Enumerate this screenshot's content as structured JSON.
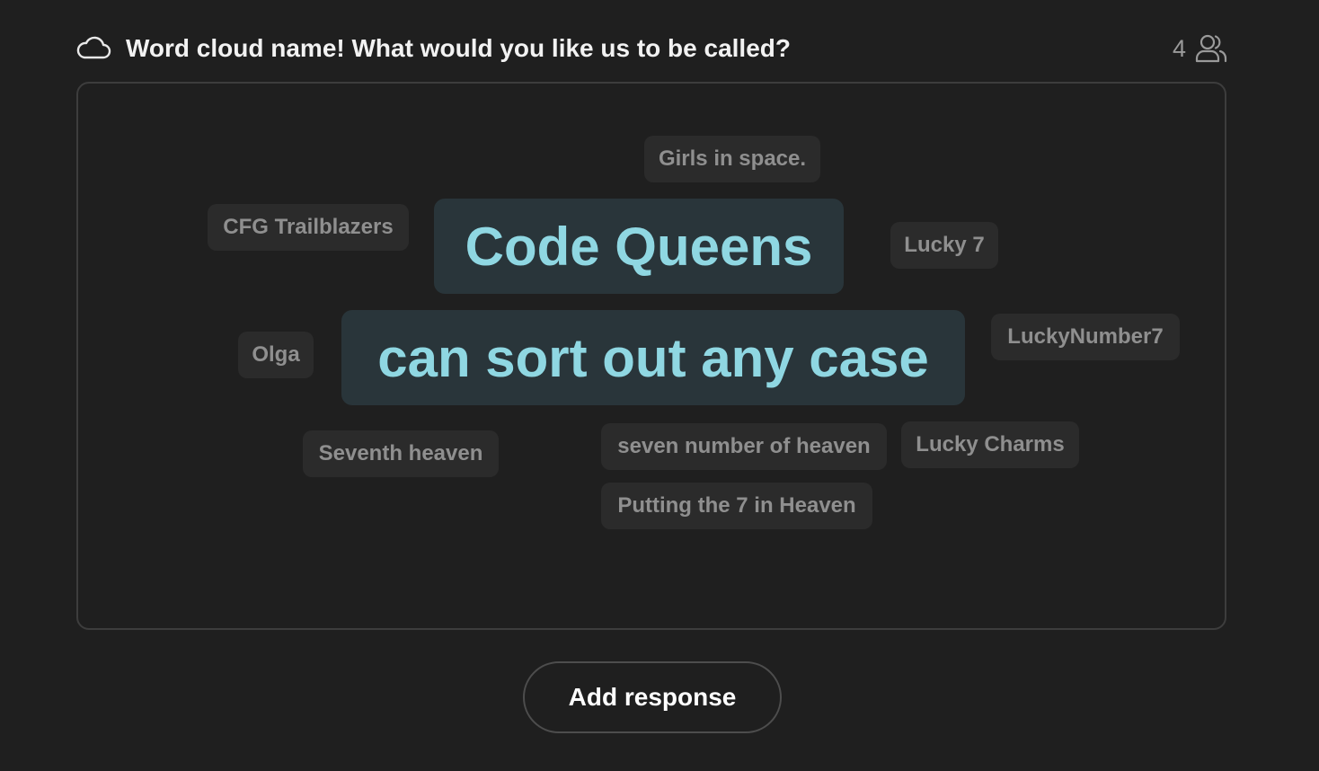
{
  "header": {
    "icon": "cloud-icon",
    "question": "Word cloud name! What would you like us to be called?",
    "participant_count": "4",
    "participants_icon": "people-icon"
  },
  "word_cloud": {
    "words": [
      {
        "text": "Girls in space.",
        "emphasis": "normal"
      },
      {
        "text": "CFG Trailblazers",
        "emphasis": "normal"
      },
      {
        "text": "Code Queens",
        "emphasis": "large"
      },
      {
        "text": "Lucky 7",
        "emphasis": "normal"
      },
      {
        "text": "Olga",
        "emphasis": "normal"
      },
      {
        "text": "can sort out any case",
        "emphasis": "large"
      },
      {
        "text": "LuckyNumber7",
        "emphasis": "normal"
      },
      {
        "text": "Seventh heaven",
        "emphasis": "normal"
      },
      {
        "text": "seven number of heaven",
        "emphasis": "normal"
      },
      {
        "text": "Lucky Charms",
        "emphasis": "normal"
      },
      {
        "text": "Putting the 7 in Heaven",
        "emphasis": "normal"
      }
    ]
  },
  "actions": {
    "add_response_label": "Add response"
  },
  "colors": {
    "background": "#1f1f1f",
    "chip_background": "#2b2b2b",
    "chip_text": "#8f8f8f",
    "highlight_background": "#29353a",
    "highlight_text": "#8fd7e2"
  }
}
